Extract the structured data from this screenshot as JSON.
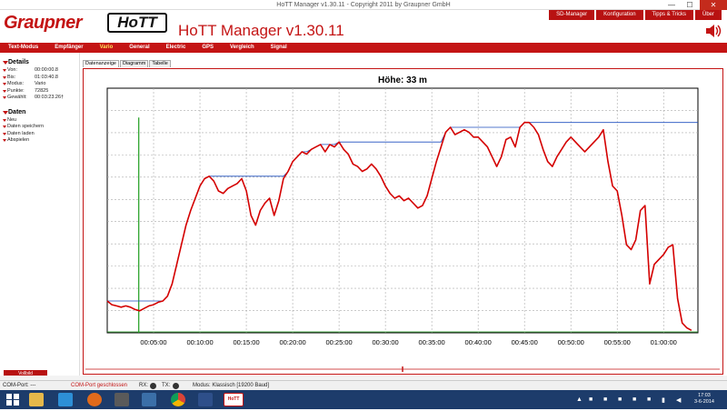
{
  "window": {
    "title": "HoTT Manager v1.30.11 - Copyright 2011 by Graupner GmbH",
    "minimize": "—",
    "maximize": "☐",
    "close": "✕"
  },
  "header": {
    "brand": "Graupner",
    "logo": "HoTT",
    "app_title": "HoTT Manager v1.30.11",
    "menu": [
      "SD-Manager",
      "Konfiguration",
      "Tipps & Tricks",
      "Über"
    ],
    "speaker_icon": "speaker-icon"
  },
  "tabs": [
    "Text-Modus",
    "Empfänger",
    "Vario",
    "General",
    "Electric",
    "GPS",
    "Vergleich",
    "Signal"
  ],
  "active_tab": "Vario",
  "sidebar": {
    "details_title": "Details",
    "details": [
      {
        "key": "Von:",
        "value": "00:00:00.8"
      },
      {
        "key": "Bis:",
        "value": "01:03:40.8"
      },
      {
        "key": "Modus:",
        "value": "Vario"
      },
      {
        "key": "Punkte:",
        "value": "72825"
      },
      {
        "key": "Gewählt:",
        "value": "00:03:23.26†"
      }
    ],
    "data_title": "Daten",
    "data_items": [
      "Neu",
      "Daten speichern",
      "Daten laden",
      "Abspielen"
    ],
    "fullscreen": "Vollbild"
  },
  "subtabs": [
    "Datenanzeige",
    "Diagramm",
    "Tabelle"
  ],
  "chart_data": {
    "type": "line",
    "title": "Höhe: 33 m",
    "x_tick_labels": [
      "00:05:00",
      "00:10:00",
      "00:15:00",
      "00:20:00",
      "00:25:00",
      "00:30:00",
      "00:35:00",
      "00:40:00",
      "00:45:00",
      "00:50:00",
      "00:55:00",
      "01:00:00"
    ],
    "x_ticks_minutes": [
      5,
      10,
      15,
      20,
      25,
      30,
      35,
      40,
      45,
      50,
      55,
      60
    ],
    "xlim_minutes": [
      0,
      63.7
    ],
    "y_gridlines": 11,
    "grid": true,
    "series": [
      {
        "color": "#d40000",
        "x_minutes": [
          0,
          0.5,
          1,
          1.5,
          2,
          2.5,
          3,
          3.5,
          4,
          4.5,
          5,
          5.5,
          6,
          6.5,
          7,
          7.5,
          8,
          8.5,
          9,
          9.5,
          10,
          10.5,
          11,
          11.5,
          12,
          12.5,
          13,
          13.5,
          14,
          14.5,
          15,
          15.5,
          16,
          16.5,
          17,
          17.5,
          18,
          18.5,
          19,
          19.5,
          20,
          20.5,
          21,
          21.5,
          22,
          22.5,
          23,
          23.5,
          24,
          24.5,
          25,
          25.5,
          26,
          26.5,
          27,
          27.5,
          28,
          28.5,
          29,
          29.5,
          30,
          30.5,
          31,
          31.5,
          32,
          32.5,
          33,
          33.5,
          34,
          34.5,
          35,
          35.5,
          36,
          36.5,
          37,
          37.5,
          38,
          38.5,
          39,
          39.5,
          40,
          40.5,
          41,
          41.5,
          42,
          42.5,
          43,
          43.5,
          44,
          44.5,
          45,
          45.5,
          46,
          46.5,
          47,
          47.5,
          48,
          48.5,
          49,
          49.5,
          50,
          50.5,
          51,
          51.5,
          52,
          52.5,
          53,
          53.5,
          54,
          54.5,
          55,
          55.5,
          56,
          56.5,
          57,
          57.5,
          58,
          58.5,
          59,
          59.5,
          60,
          60.5,
          61,
          61.5,
          62,
          62.5,
          63,
          63.5,
          63.7
        ],
        "y": [
          13,
          11.5,
          11,
          10.5,
          11,
          10.5,
          9.5,
          9,
          10,
          11,
          11.5,
          12.5,
          13,
          15,
          20,
          28,
          36,
          44,
          50,
          55,
          60,
          63,
          64,
          62,
          58,
          57,
          59,
          60,
          61,
          63,
          58,
          48,
          44,
          50,
          53,
          55,
          48,
          54,
          63,
          66,
          70,
          72,
          74,
          73,
          75,
          76,
          77,
          74,
          77,
          76,
          78,
          75,
          73,
          69,
          68,
          66,
          67,
          69,
          67,
          64,
          60,
          57,
          55,
          56,
          54,
          55,
          53,
          51,
          52,
          56,
          63,
          70,
          76,
          82,
          84,
          81,
          82,
          83,
          82,
          80,
          80,
          78,
          76,
          72,
          68,
          72,
          79,
          80,
          76,
          84,
          86,
          86,
          84,
          81,
          75,
          70,
          68,
          72,
          75,
          78,
          80,
          78,
          76,
          74,
          76,
          78,
          80,
          83,
          70,
          60,
          58,
          48,
          36,
          34,
          38,
          50,
          52,
          20,
          28,
          30,
          32,
          35,
          36,
          14,
          4,
          2,
          1
        ]
      }
    ],
    "reference_line": {
      "color": "#1f4fbf"
    },
    "cursor_line_minutes": 3.4,
    "cursor_color": "#1e9e1e"
  },
  "status": {
    "com_port": "COM-Port: ---",
    "com_state": "COM-Port geschlossen",
    "rx": "RX:",
    "tx": "TX:",
    "mode": "Modus: Klassisch [19200 Baud]"
  },
  "taskbar": {
    "clock_time": "17:03",
    "clock_date": "3-6-2014",
    "active_app": "HoTT"
  }
}
